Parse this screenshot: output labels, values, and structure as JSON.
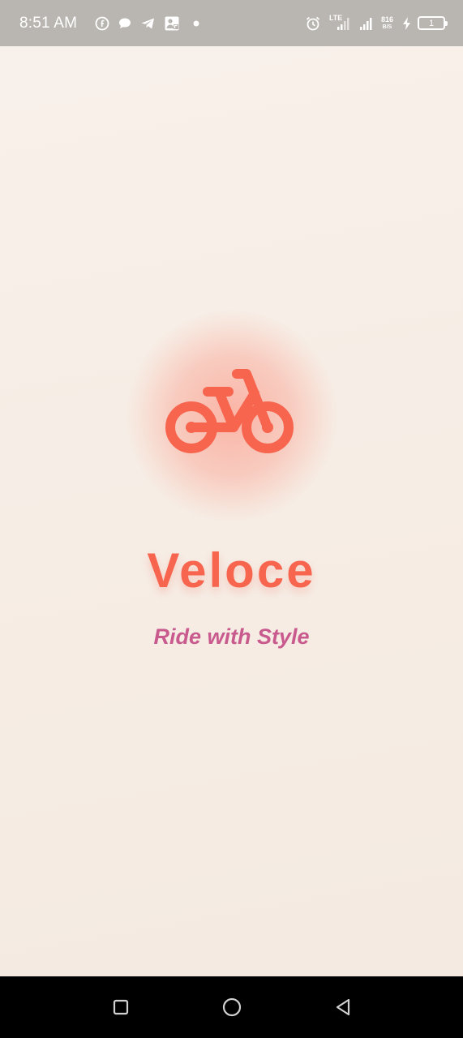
{
  "status_bar": {
    "time": "8:51 AM",
    "left_icons": [
      "facebook-icon",
      "chat-bubble-icon",
      "telegram-icon",
      "gallery-icon",
      "dot-icon"
    ],
    "right_icons": [
      "alarm-icon",
      "lte-signal-icon",
      "signal-icon",
      "network-speed",
      "charging-icon",
      "battery-icon"
    ],
    "network_speed_value": "816",
    "network_speed_unit": "B/S",
    "lte_label": "LTE",
    "battery_level": "1"
  },
  "splash": {
    "logo_icon": "bicycle-icon",
    "title": "Veloce",
    "tagline": "Ride with Style",
    "colors": {
      "title": "#f7654f",
      "tagline": "#c95a8d",
      "icon": "#f7654f",
      "background": "#f6ede4"
    }
  },
  "nav_bar": {
    "buttons": [
      "recent-apps-button",
      "home-button",
      "back-button"
    ]
  }
}
